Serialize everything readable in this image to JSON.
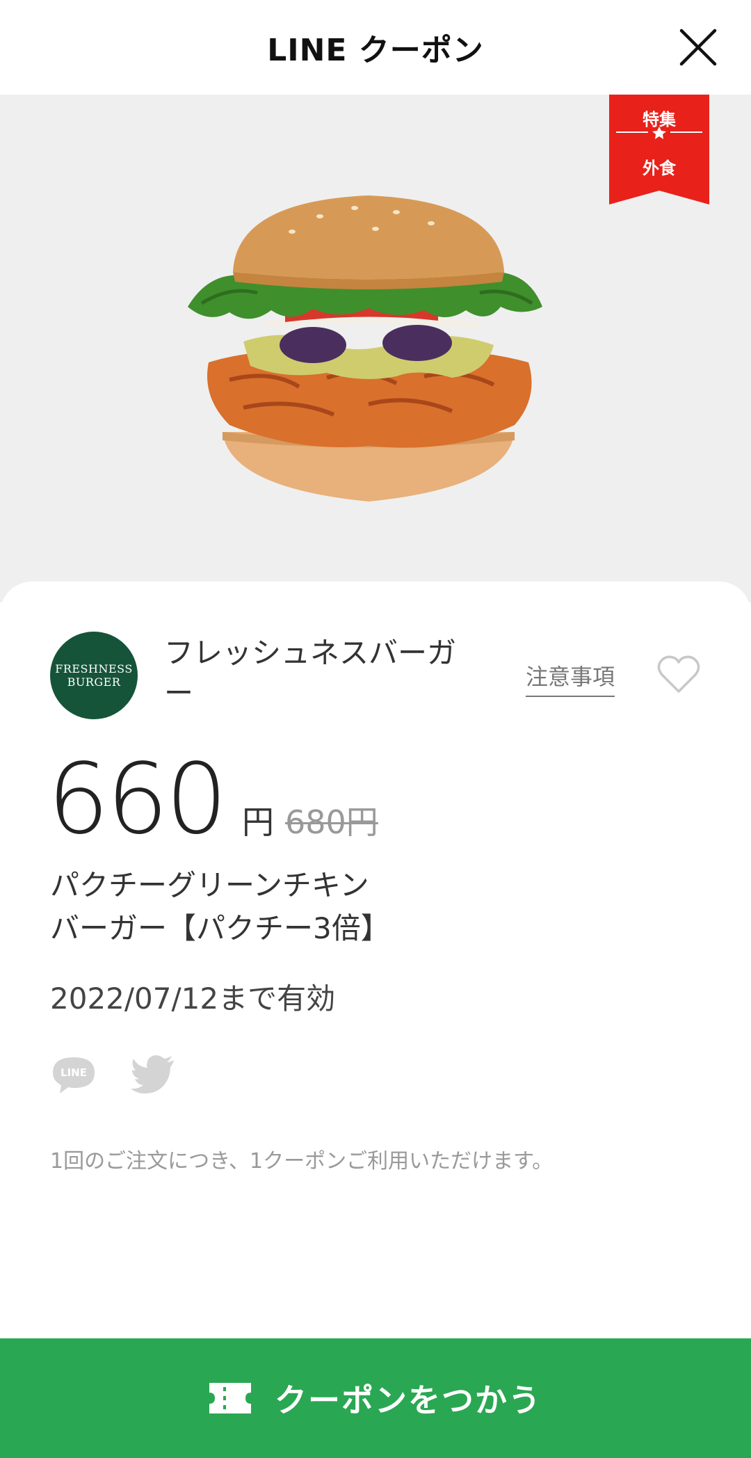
{
  "header": {
    "title": "LINE クーポン"
  },
  "badge": {
    "top": "特集",
    "bottom": "外食",
    "color": "#e8211a"
  },
  "hero": {
    "image": "burger-photo"
  },
  "shop": {
    "logo_line1": "FRESHNESS",
    "logo_line2": "BURGER",
    "name": "フレッシュネスバーガー",
    "logo_color": "#16543a"
  },
  "notes_link": "注意事項",
  "price": {
    "value": "660",
    "unit": "円",
    "original": "680円"
  },
  "product": {
    "name_line1": "パクチーグリーンチキン",
    "name_line2": "バーガー【パクチー3倍】"
  },
  "validity": "2022/07/12まで有効",
  "share": {
    "line_label": "LINE"
  },
  "note": "1回のご注文につき、1クーポンご利用いただけます。",
  "cta": {
    "label": "クーポンをつかう",
    "color": "#2aa752"
  }
}
